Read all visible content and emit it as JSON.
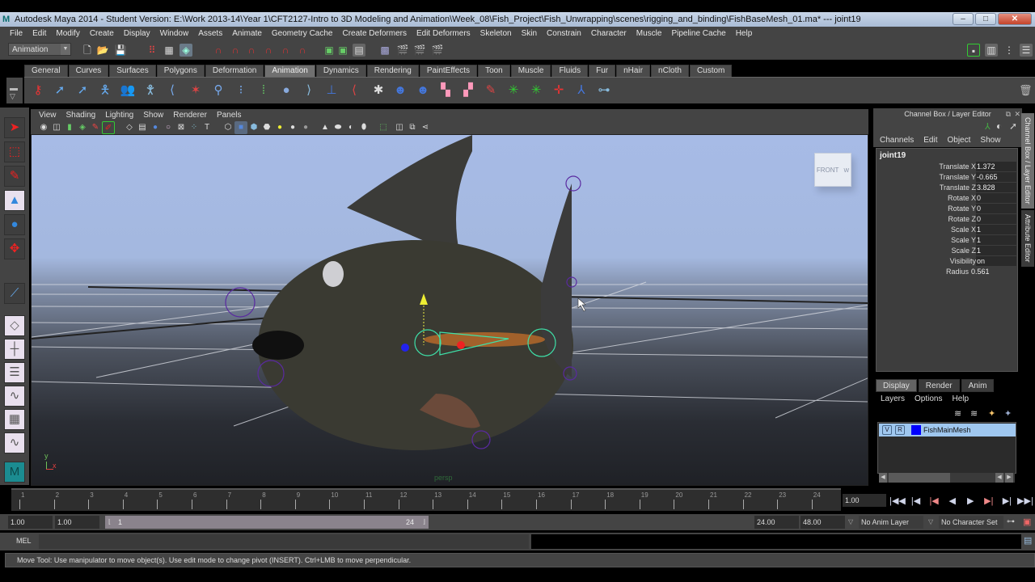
{
  "window": {
    "title": "Autodesk Maya 2014 - Student Version: E:\\Work 2013-14\\Year 1\\CFT2127-Intro to 3D Modeling and Animation\\Week_08\\Fish_Project\\Fish_Unwrapping\\scenes\\rigging_and_binding\\FishBaseMesh_01.ma*   ---   joint19",
    "minimize": "–",
    "maximize": "□",
    "close": "✕"
  },
  "menubar": [
    "File",
    "Edit",
    "Modify",
    "Create",
    "Display",
    "Window",
    "Assets",
    "Animate",
    "Geometry Cache",
    "Create Deformers",
    "Edit Deformers",
    "Skeleton",
    "Skin",
    "Constrain",
    "Character",
    "Muscle",
    "Pipeline Cache",
    "Help"
  ],
  "statusline": {
    "menu_set": "Animation",
    "icons": [
      "new-scene-icon",
      "open-scene-icon",
      "save-scene-icon",
      "select-hierarchy-icon",
      "select-object-icon",
      "select-component-icon",
      "snap-grid-icon",
      "snap-curve-icon",
      "snap-point-icon",
      "snap-view-plane-icon",
      "snap-live-surface-icon",
      "snap-magnet-icon",
      "input-ops-icon",
      "output-ops-icon",
      "construction-history-icon",
      "render-view-icon",
      "render-current-icon",
      "ipr-render-icon",
      "render-settings-icon"
    ]
  },
  "shelf": {
    "tabs": [
      "General",
      "Curves",
      "Surfaces",
      "Polygons",
      "Deformation",
      "Animation",
      "Dynamics",
      "Rendering",
      "PaintEffects",
      "Toon",
      "Muscle",
      "Fluids",
      "Fur",
      "nHair",
      "nCloth",
      "Custom"
    ],
    "active_tab": "Animation",
    "icons": [
      "set-key-icon",
      "ik-handle-icon",
      "ik-spline-icon",
      "hik-icon",
      "character-icon",
      "joint-tool-icon",
      "insert-joint-icon",
      "mirror-joint-icon",
      "joint-orient-icon",
      "ik-handle-tool-icon",
      "ik-spline-tool-icon",
      "delete-icon",
      "connect-joint-icon",
      "disconnect-joint-icon",
      "orient-joint-icon",
      "reroot-icon",
      "skeleton-icon",
      "bind-skin-icon",
      "smooth-bind-icon",
      "paint-weights-icon",
      "copy-weights-icon",
      "mirror-weights-icon",
      "paint-skin-icon",
      "muscle-icon",
      "point-constraint-icon",
      "aim-constraint-icon",
      "orient-constraint-icon",
      "parent-constraint-icon"
    ]
  },
  "toolbox": [
    "select-tool-icon",
    "lasso-tool-icon",
    "paint-select-icon",
    "move-tool-icon",
    "rotate-tool-icon",
    "scale-tool-icon",
    "joint-tool-icon",
    "single-view-layout-icon",
    "four-view-layout-icon",
    "outliner-layout-icon",
    "graph-editor-layout-icon",
    "hypershade-layout-icon",
    "dope-sheet-layout-icon",
    "maya-logo-icon"
  ],
  "viewport": {
    "menus": [
      "View",
      "Shading",
      "Lighting",
      "Show",
      "Renderer",
      "Panels"
    ],
    "viewcube_label": "FRONT",
    "viewcube_side": "W",
    "camera_label": "persp",
    "axis_y": "y",
    "axis_x": "x"
  },
  "channel_box": {
    "header": "Channel Box / Layer Editor",
    "menus": [
      "Channels",
      "Edit",
      "Object",
      "Show"
    ],
    "node": "joint19",
    "attributes": [
      {
        "label": "Translate X",
        "value": "1.372"
      },
      {
        "label": "Translate Y",
        "value": "-0.665"
      },
      {
        "label": "Translate Z",
        "value": "3.828"
      },
      {
        "label": "Rotate X",
        "value": "0"
      },
      {
        "label": "Rotate Y",
        "value": "0"
      },
      {
        "label": "Rotate Z",
        "value": "0"
      },
      {
        "label": "Scale X",
        "value": "1"
      },
      {
        "label": "Scale Y",
        "value": "1"
      },
      {
        "label": "Scale Z",
        "value": "1"
      },
      {
        "label": "Visibility",
        "value": "on"
      },
      {
        "label": "Radius",
        "value": "0.561"
      }
    ],
    "side_tabs": [
      "Channel Box / Layer Editor",
      "Attribute Editor"
    ]
  },
  "layer_editor": {
    "tabs": [
      "Display",
      "Render",
      "Anim"
    ],
    "active_tab": "Display",
    "menus": [
      "Layers",
      "Options",
      "Help"
    ],
    "layers": [
      {
        "visible": "V",
        "reference": "R",
        "color": "#0000ff",
        "name": "FishMainMesh"
      }
    ]
  },
  "timeline": {
    "ticks": [
      "1",
      "2",
      "3",
      "4",
      "5",
      "6",
      "7",
      "8",
      "9",
      "10",
      "11",
      "12",
      "13",
      "14",
      "15",
      "16",
      "17",
      "18",
      "19",
      "20",
      "21",
      "22",
      "23",
      "24"
    ],
    "current_frame": "1.00",
    "playback": [
      "⏮",
      "⏮",
      "⏮",
      "◀",
      "▶",
      "⏭",
      "⏭",
      "⏭"
    ]
  },
  "range": {
    "start_time": "1.00",
    "playback_start": "1.00",
    "range_start_label": "1",
    "range_end_label": "24",
    "playback_end": "24.00",
    "end_time": "48.00",
    "anim_layer": "No Anim Layer",
    "character_set": "No Character Set"
  },
  "command_line": {
    "label": "MEL",
    "input": "",
    "output": ""
  },
  "help_line": "Move Tool: Use manipulator to move object(s). Use edit mode to change pivot (INSERT).  Ctrl+LMB to move perpendicular."
}
